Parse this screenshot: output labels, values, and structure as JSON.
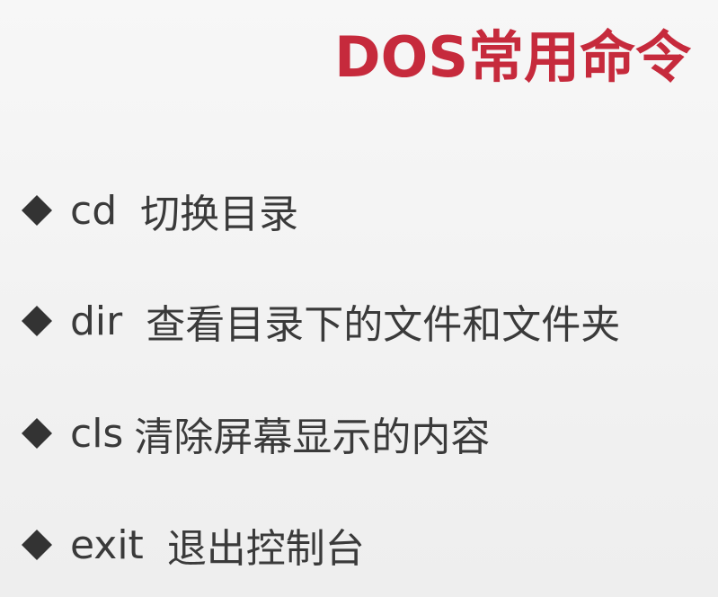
{
  "slide": {
    "title": "DOS常用命令",
    "accent_color": "#c62a3c",
    "text_color": "#3a3a3a",
    "bullet_icon": "diamond-icon",
    "items": [
      {
        "command": "cd",
        "description": "切换目录"
      },
      {
        "command": "dir",
        "description": "查看目录下的文件和文件夹"
      },
      {
        "command": "cls",
        "description": "清除屏幕显示的内容"
      },
      {
        "command": "exit",
        "description": "退出控制台"
      }
    ]
  }
}
